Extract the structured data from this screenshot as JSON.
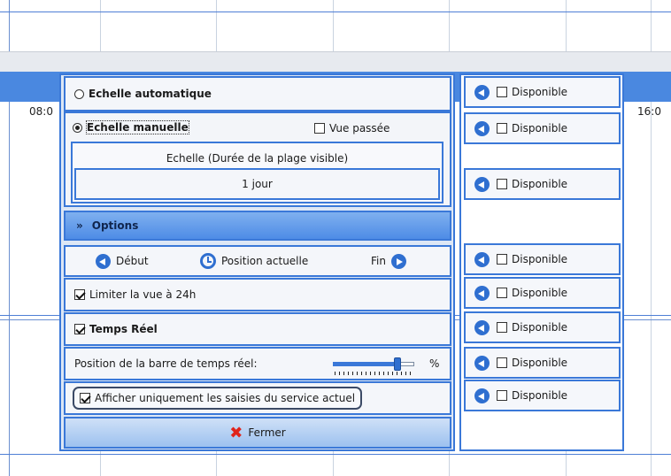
{
  "background": {
    "hours": [
      "08:0",
      "16:0"
    ],
    "row_number": "2"
  },
  "popup": {
    "auto_scale_label": "Echelle automatique",
    "manual_scale_label": "Echelle manuelle",
    "past_view_label": "Vue passée",
    "scale_caption": "Echelle (Durée de la plage visible)",
    "scale_value": "1 jour",
    "options_label": "Options",
    "start_label": "Début",
    "current_position_label": "Position actuelle",
    "end_label": "Fin",
    "limit_24h_label": "Limiter la vue à 24h",
    "realtime_label": "Temps Réel",
    "bar_position_label": "Position de la barre de temps réel:",
    "percent_symbol": "%",
    "bar_position_value": 0.82,
    "service_only_label": "Afficher uniquement les saisies du service actuel",
    "close_label": "Fermer",
    "states": {
      "auto_scale": false,
      "manual_scale": true,
      "past_view": false,
      "limit_24h": true,
      "realtime": true,
      "service_only": true
    }
  },
  "slots": [
    {
      "label": "Disponible",
      "checked": false
    },
    {
      "label": "Disponible",
      "checked": false
    },
    {
      "label": "Disponible",
      "checked": false
    },
    {
      "label": "Disponible",
      "checked": false
    },
    {
      "label": "Disponible",
      "checked": false
    },
    {
      "label": "Disponible",
      "checked": false
    },
    {
      "label": "Disponible",
      "checked": false
    },
    {
      "label": "Disponible",
      "checked": false
    }
  ],
  "colors": {
    "accent": "#3a78d8",
    "header_blue": "#4a88e0",
    "close_icon": "#e0241b"
  }
}
